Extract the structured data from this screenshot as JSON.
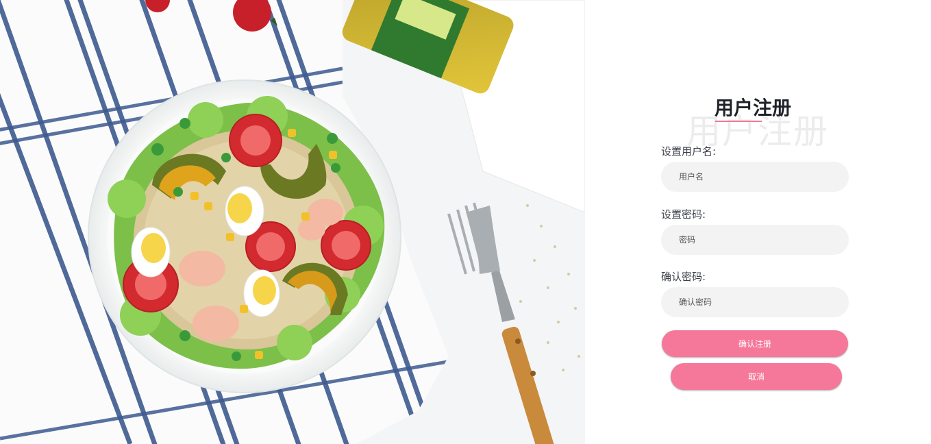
{
  "hero": {
    "image_alt": "salad-bowl-photo"
  },
  "register": {
    "title": "用户注册",
    "title_watermark": "用户注册",
    "username_label": "设置用户名:",
    "username_placeholder": "用户名",
    "password_label": "设置密码:",
    "password_placeholder": "密码",
    "confirm_label": "确认密码:",
    "confirm_placeholder": "确认密码",
    "submit_label": "确认注册",
    "cancel_label": "取消"
  },
  "colors": {
    "accent": "#f5789a",
    "input_bg": "#f3f3f3",
    "title": "#1f2227"
  }
}
